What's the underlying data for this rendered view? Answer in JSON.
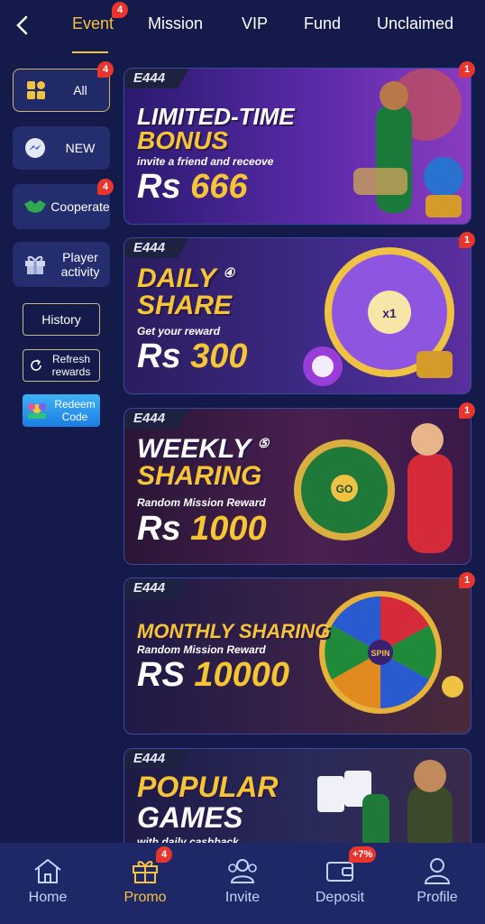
{
  "nav": {
    "tabs": [
      {
        "label": "Event",
        "badge": "4",
        "active": true
      },
      {
        "label": "Mission"
      },
      {
        "label": "VIP"
      },
      {
        "label": "Fund"
      },
      {
        "label": "Unclaimed"
      }
    ]
  },
  "sidebar": {
    "items": [
      {
        "label": "All",
        "badge": "4"
      },
      {
        "label": "NEW"
      },
      {
        "label": "Cooperate",
        "badge": "4"
      },
      {
        "label": "Player activity"
      }
    ],
    "history": "History",
    "refresh": "Refresh rewards",
    "redeem": "Redeem Code"
  },
  "banners": [
    {
      "brand": "E444",
      "line1": "LIMITED-TIME",
      "line2": "BONUS",
      "sub": "invite a friend and receove",
      "cur": "Rs",
      "amount": "666",
      "badge": "1"
    },
    {
      "brand": "E444",
      "line1": "DAILY",
      "sup": "④",
      "line2": "SHARE",
      "sub": "Get your reward",
      "cur": "Rs",
      "amount": "300",
      "badge": "1"
    },
    {
      "brand": "E444",
      "line1": "WEEKLY",
      "sup": "⑤",
      "line2": "SHARING",
      "sub": "Random Mission Reward",
      "cur": "Rs",
      "amount": "1000",
      "badge": "1"
    },
    {
      "brand": "E444",
      "line1": "MONTHLY SHARING",
      "sub": "Random Mission Reward",
      "cur": "RS",
      "amount": "10000",
      "badge": "1"
    },
    {
      "brand": "E444",
      "line1": "POPULAR",
      "line2": "GAMES",
      "sub": "with daily cashback"
    }
  ],
  "bottom_nav": {
    "items": [
      {
        "label": "Home"
      },
      {
        "label": "Promo",
        "badge": "4",
        "active": true
      },
      {
        "label": "Invite"
      },
      {
        "label": "Deposit",
        "badge": "+7%"
      },
      {
        "label": "Profile"
      }
    ]
  },
  "colors": {
    "background": "#141b4a",
    "accent": "#f5c243",
    "badge": "#e8352d"
  }
}
